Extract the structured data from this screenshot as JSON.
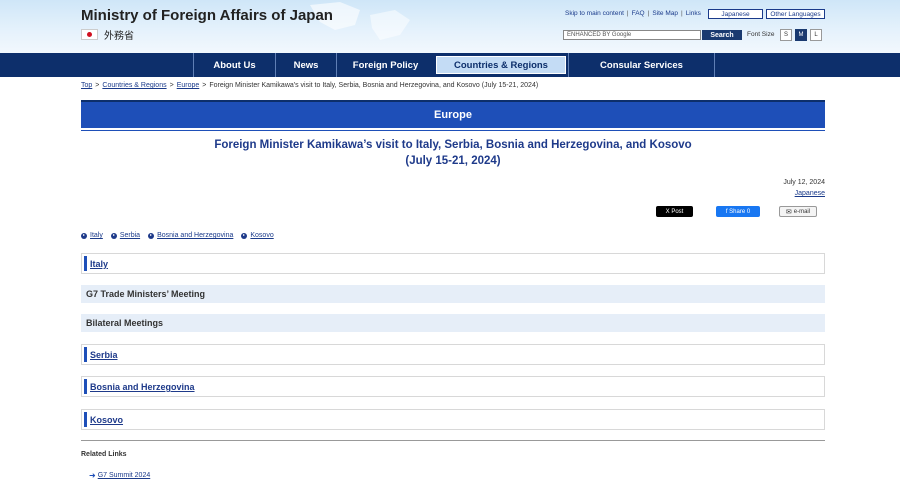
{
  "header": {
    "site_title": "Ministry of Foreign Affairs of Japan",
    "site_title_jp": "外務省",
    "util_links": [
      "Skip to main content",
      "FAQ",
      "Site Map",
      "Links"
    ],
    "lang_japanese": "Japanese",
    "lang_other": "Other Languages",
    "search_placeholder": "ENHANCED BY Google",
    "search_button": "Search",
    "font_size_label": "Font Size",
    "font_sizes": [
      "S",
      "M",
      "L"
    ]
  },
  "nav": {
    "items": [
      "About Us",
      "News",
      "Foreign Policy",
      "Countries & Regions",
      "Consular Services"
    ],
    "active_index": 3
  },
  "breadcrumb": {
    "items": [
      "Top",
      "Countries & Regions",
      "Europe"
    ],
    "current": "Foreign Minister Kamikawa's visit to Italy, Serbia, Bosnia and Herzegovina, and Kosovo (July 15-21, 2024)"
  },
  "section": {
    "title": "Europe"
  },
  "article": {
    "title_line1": "Foreign Minister Kamikawa’s visit to Italy, Serbia, Bosnia and Herzegovina, and Kosovo",
    "title_line2": "(July 15-21, 2024)",
    "date": "July 12, 2024",
    "japanese_link": "Japanese",
    "share_x": "X Post",
    "share_fb": "f Share 0",
    "share_mail": "e-mail",
    "anchors": [
      "Italy",
      "Serbia",
      "Bosnia and Herzegovina",
      "Kosovo"
    ],
    "sections": {
      "italy": "Italy",
      "g7": "G7 Trade Ministers’ Meeting",
      "bilateral": "Bilateral Meetings",
      "serbia": "Serbia",
      "bosnia": "Bosnia and Herzegovina",
      "kosovo": "Kosovo"
    }
  },
  "related": {
    "title": "Related Links",
    "links": [
      "G7 Summit 2024"
    ]
  }
}
